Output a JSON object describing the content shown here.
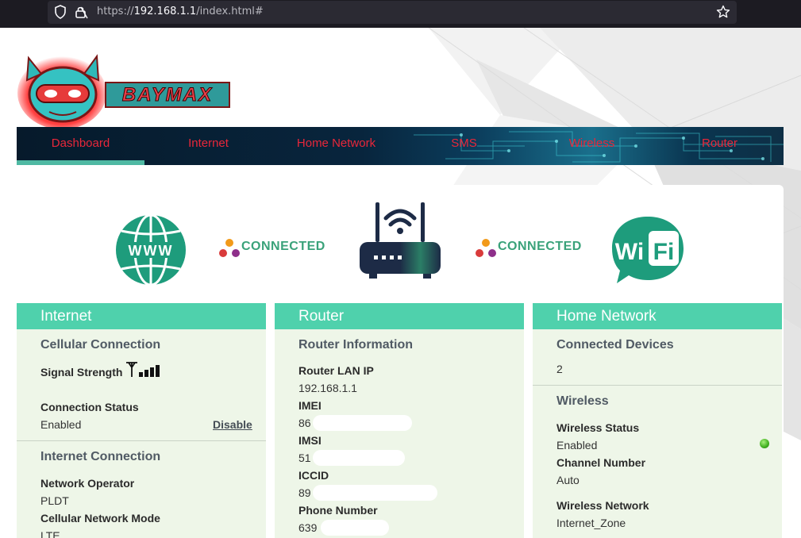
{
  "browser": {
    "url_prefix": "https://",
    "url_host": "192.168.1.1",
    "url_path": "/index.html#"
  },
  "logo": {
    "text": "BAYMAX"
  },
  "nav": {
    "items": [
      {
        "label": "Dashboard"
      },
      {
        "label": "Internet"
      },
      {
        "label": "Home Network"
      },
      {
        "label": "SMS"
      },
      {
        "label": "Wireless"
      },
      {
        "label": "Router"
      }
    ]
  },
  "status": {
    "internet_connection_label": "CONNECTED",
    "wifi_connection_label": "CONNECTED",
    "globe_text": "WWW",
    "wifi_text_wi": "Wi",
    "wifi_text_fi": "Fi"
  },
  "internet_panel": {
    "title": "Internet",
    "cellular_title": "Cellular Connection",
    "signal_label": "Signal Strength",
    "connection_status_label": "Connection Status",
    "connection_status_value": "Enabled",
    "disable_link": "Disable",
    "internet_connection_title": "Internet Connection",
    "network_operator_label": "Network Operator",
    "network_operator_value": "PLDT",
    "network_mode_label": "Cellular Network Mode",
    "network_mode_value": "LTE"
  },
  "router_panel": {
    "title": "Router",
    "info_title": "Router Information",
    "lan_ip_label": "Router LAN IP",
    "lan_ip_value": "192.168.1.1",
    "imei_label": "IMEI",
    "imei_value": "86",
    "imsi_label": "IMSI",
    "imsi_value": "51",
    "iccid_label": "ICCID",
    "iccid_value": "89",
    "phone_label": "Phone Number",
    "phone_value": "639"
  },
  "home_panel": {
    "title": "Home Network",
    "devices_title": "Connected Devices",
    "devices_value": "2",
    "wireless_title": "Wireless",
    "wireless_status_label": "Wireless Status",
    "wireless_status_value": "Enabled",
    "channel_label": "Channel Number",
    "channel_value": "Auto",
    "network_label": "Wireless Network",
    "network_value": "Internet_Zone"
  },
  "colors": {
    "accent": "#4fd1ac",
    "nav_text": "#e8273a",
    "panel_bg": "#eef6e8",
    "status_green": "#3fae1f"
  }
}
